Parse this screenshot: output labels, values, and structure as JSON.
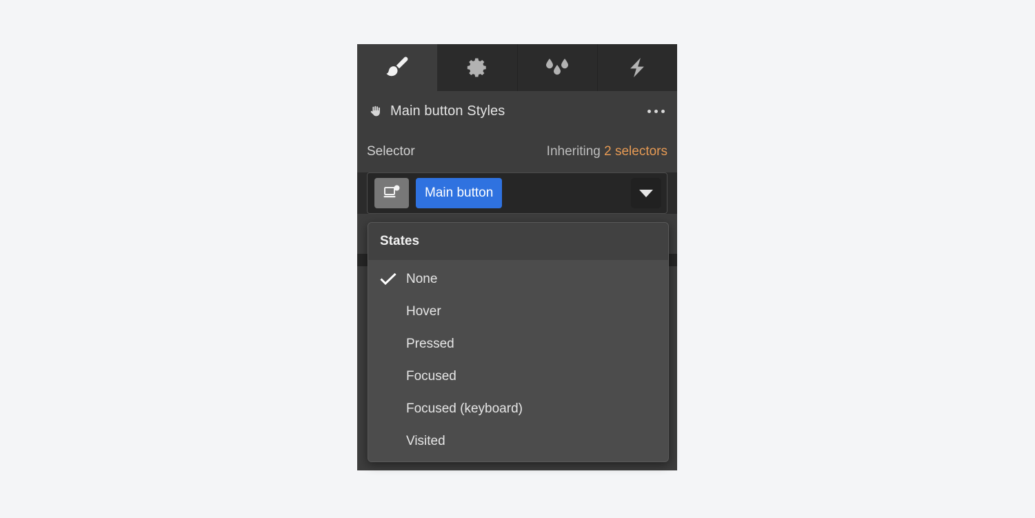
{
  "panel": {
    "title": "Main button Styles",
    "title_icon": "hand-grab-icon",
    "more_icon": "more-options-icon"
  },
  "tabs": [
    {
      "id": "style",
      "icon": "paintbrush-icon",
      "active": true
    },
    {
      "id": "settings",
      "icon": "gear-icon",
      "active": false
    },
    {
      "id": "effects",
      "icon": "droplets-icon",
      "active": false
    },
    {
      "id": "interactions",
      "icon": "lightning-bolt-icon",
      "active": false
    }
  ],
  "selector": {
    "label": "Selector",
    "inheriting_text": "Inheriting",
    "inheriting_count": "2 selectors",
    "breakpoint_icon": "desktop-breakpoint-icon",
    "tag_label": "Main button",
    "caret_icon": "chevron-down-icon"
  },
  "dropdown": {
    "header": "States",
    "items": [
      {
        "label": "None",
        "selected": true
      },
      {
        "label": "Hover",
        "selected": false
      },
      {
        "label": "Pressed",
        "selected": false
      },
      {
        "label": "Focused",
        "selected": false
      },
      {
        "label": "Focused (keyboard)",
        "selected": false
      },
      {
        "label": "Visited",
        "selected": false
      }
    ]
  },
  "colors": {
    "page_background": "#f4f5f7",
    "panel_background": "#3d3d3d",
    "tabbar_background": "#2b2b2b",
    "tab_active_background": "#3d3d3d",
    "field_background": "#262626",
    "accent_blue": "#2f72e0",
    "accent_orange": "#e69a54",
    "dropdown_background": "#4c4c4c",
    "dropdown_header_background": "#414141",
    "text_primary": "#e6e6e6",
    "icon_gray": "#b2b2b2"
  }
}
